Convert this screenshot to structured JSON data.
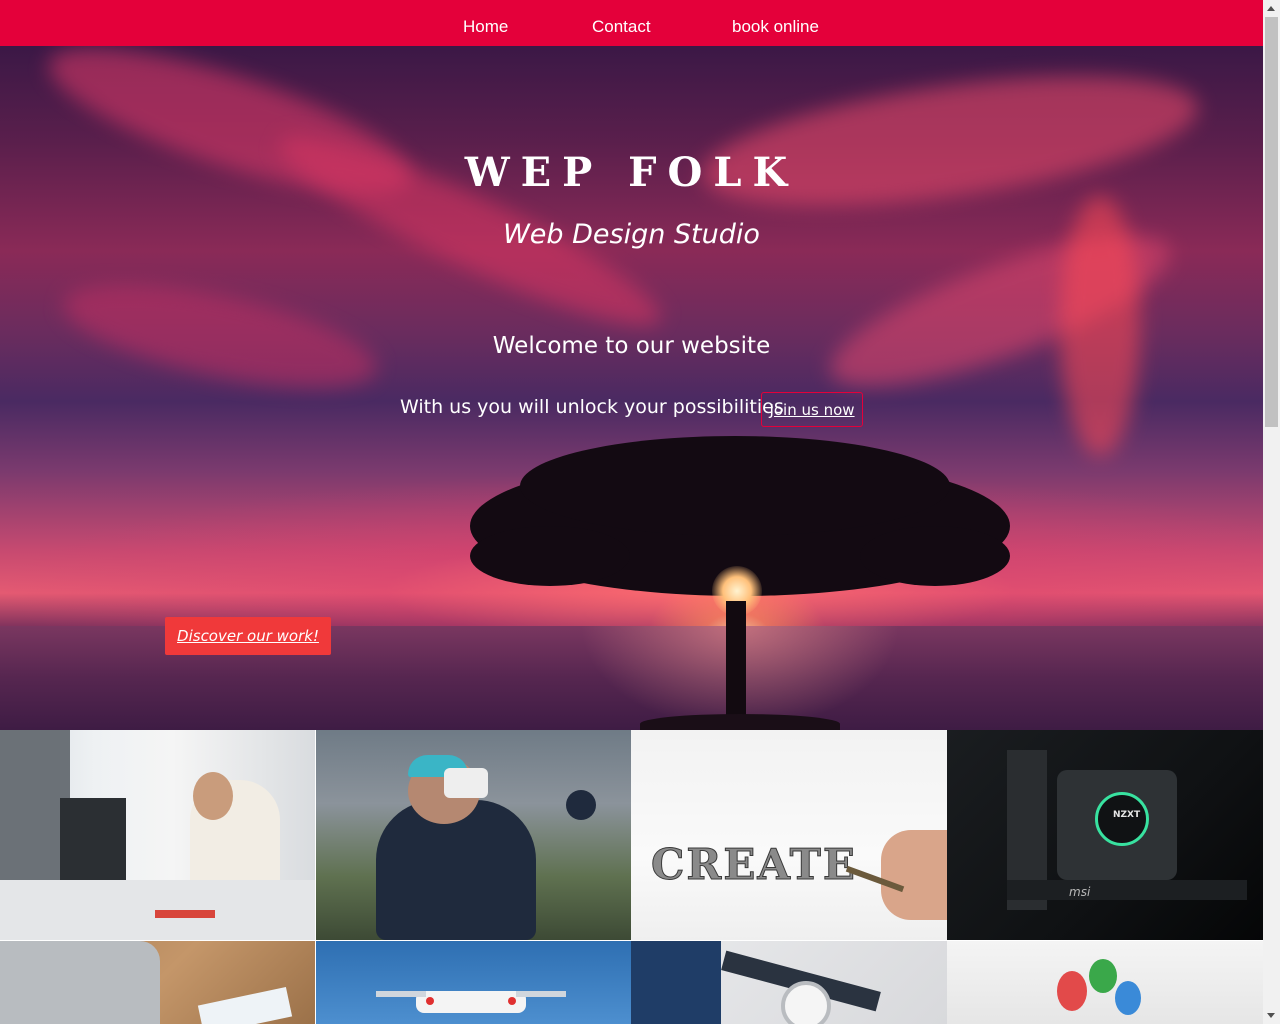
{
  "nav": {
    "items": [
      {
        "label": "Home"
      },
      {
        "label": "Contact"
      },
      {
        "label": "book online"
      }
    ]
  },
  "hero": {
    "title": "WEP FOLK",
    "subtitle": "Web Design Studio",
    "welcome": "Welcome to our website",
    "tagline": "With us you will unlock your possibilities",
    "join_button": "Join us now",
    "discover_button": "Discover our work!"
  },
  "gallery": {
    "tiles": [
      {
        "icon": "office-worker-image"
      },
      {
        "icon": "vr-headset-image",
        "text": ""
      },
      {
        "icon": "create-sketch-image",
        "text": "CREATE"
      },
      {
        "icon": "pc-hardware-image",
        "brand": "NZXT",
        "maker": "msi"
      },
      {
        "icon": "laptop-desk-image"
      },
      {
        "icon": "drone-image"
      },
      {
        "icon": "wristwatch-image"
      },
      {
        "icon": "colorful-figures-image"
      }
    ]
  },
  "colors": {
    "nav_bg": "#e4003a",
    "button_accent": "#f0393a",
    "join_border": "#e4003a"
  }
}
